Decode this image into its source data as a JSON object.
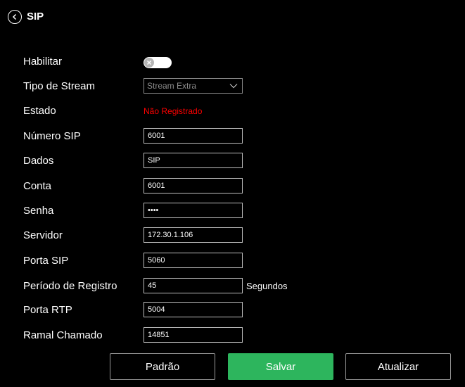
{
  "header": {
    "title": "SIP",
    "back_icon": "chevron-left-circle-icon"
  },
  "form": {
    "habilitar": {
      "label": "Habilitar",
      "enabled": false,
      "toggle_icon": "close-icon"
    },
    "tipo_stream": {
      "label": "Tipo de Stream",
      "value": "Stream Extra"
    },
    "estado": {
      "label": "Estado",
      "value": "Não Registrado",
      "color": "#ff0000"
    },
    "numero_sip": {
      "label": "Número SIP",
      "value": "6001"
    },
    "dados": {
      "label": "Dados",
      "value": "SIP"
    },
    "conta": {
      "label": "Conta",
      "value": "6001"
    },
    "senha": {
      "label": "Senha",
      "value": "1234"
    },
    "servidor": {
      "label": "Servidor",
      "value": "172.30.1.106"
    },
    "porta_sip": {
      "label": "Porta SIP",
      "value": "5060"
    },
    "periodo_registro": {
      "label": "Período de Registro",
      "value": "45",
      "unit": "Segundos"
    },
    "porta_rtp": {
      "label": "Porta RTP",
      "value": "5004"
    },
    "ramal_chamado": {
      "label": "Ramal Chamado",
      "value": "14851"
    }
  },
  "buttons": {
    "padrao": "Padrão",
    "salvar": "Salvar",
    "atualizar": "Atualizar"
  },
  "colors": {
    "background": "#000000",
    "accent_green": "#2db55d",
    "status_red": "#ff0000"
  }
}
